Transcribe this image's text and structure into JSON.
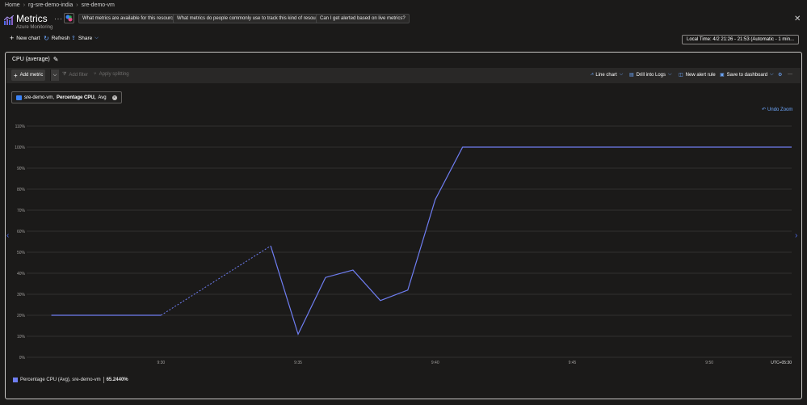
{
  "breadcrumb": {
    "items": [
      "Home",
      "rg-sre-demo-india",
      "sre-demo-vm"
    ]
  },
  "header": {
    "title": "Metrics",
    "subtitle": "Azure Monitoring",
    "more": "···",
    "suggestions": [
      "What metrics are available for this resource?",
      "What metrics do people commonly use to track this kind of resource?",
      "Can I get alerted based on live metrics?"
    ],
    "close": "✕"
  },
  "toolbar": {
    "new_chart": "New chart",
    "refresh": "Refresh",
    "share": "Share",
    "time_range": "Local Time: 4/2 21:26 - 21:53 (Automatic - 1 min..."
  },
  "panel": {
    "chart_title": "CPU (average)",
    "add_metric": "Add metric",
    "add_filter": "Add filter",
    "apply_splitting": "Apply splitting",
    "line_chart": "Line chart",
    "drill_into_logs": "Drill into Logs",
    "new_alert_rule": "New alert rule",
    "save_to_dashboard": "Save to dashboard",
    "more": "···",
    "metric_pill": {
      "resource": "sre-demo-vm,",
      "metric": "Percentage CPU,",
      "aggregation": "Avg"
    },
    "undo_zoom": "Undo Zoom"
  },
  "legend": {
    "label": "Percentage CPU (Avg), sre-demo-vm",
    "value": "65.2440%"
  },
  "colors": {
    "series": "#6f7ef2",
    "grid": "#3a3938",
    "accent": "#4f6bed"
  },
  "chart_data": {
    "type": "line",
    "title": "CPU (average)",
    "xlabel": "",
    "ylabel": "",
    "timezone_label": "UTC+05:30",
    "x_ticks": [
      "9:30",
      "9:35",
      "9:40",
      "9:45",
      "9:50"
    ],
    "y_ticks": [
      "0%",
      "10%",
      "20%",
      "30%",
      "40%",
      "50%",
      "60%",
      "70%",
      "80%",
      "90%",
      "100%",
      "110%"
    ],
    "ylim": [
      0,
      110
    ],
    "grid": true,
    "series": [
      {
        "name": "Percentage CPU (Avg), sre-demo-vm",
        "x": [
          "9:26",
          "9:27",
          "9:28",
          "9:29",
          "9:30",
          "9:34",
          "9:35",
          "9:36",
          "9:37",
          "9:38",
          "9:39",
          "9:40",
          "9:41",
          "9:42",
          "9:43",
          "9:44",
          "9:45",
          "9:46",
          "9:47",
          "9:48",
          "9:49",
          "9:50",
          "9:51",
          "9:52",
          "9:53"
        ],
        "values": [
          20,
          20,
          20,
          20,
          20,
          53,
          11,
          38,
          41.5,
          27,
          32,
          75,
          100,
          100,
          100,
          100,
          100,
          100,
          100,
          100,
          100,
          100,
          100,
          100,
          100
        ],
        "gap_between": [
          "9:30",
          "9:34"
        ]
      }
    ]
  }
}
